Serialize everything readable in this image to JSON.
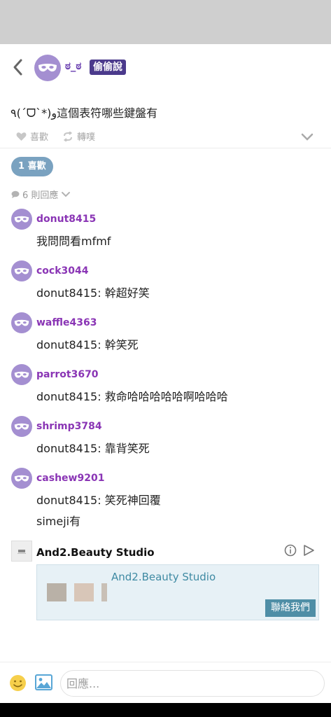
{
  "post": {
    "author": "ಠ_ಠ",
    "tag": "偷偷說",
    "text": "٩(ˊᗜˋ*)و這個表符哪些鍵盤有",
    "like_label": "喜歡",
    "share_label": "轉噗"
  },
  "likes_label": "1 喜歡",
  "replies_label": "6 則回應",
  "comments": [
    {
      "name": "donut8415",
      "text": "我問問看mfmf"
    },
    {
      "name": "cock3044",
      "text": "donut8415: 幹超好笑"
    },
    {
      "name": "waffle4363",
      "text": "donut8415: 幹笑死"
    },
    {
      "name": "parrot3670",
      "text": "donut8415: 救命哈哈哈哈哈啊哈哈哈"
    },
    {
      "name": "shrimp3784",
      "text": "donut8415: 靠背笑死"
    },
    {
      "name": "cashew9201",
      "text": "donut8415: 笑死神回覆",
      "text2": "simeji有"
    }
  ],
  "ad": {
    "name": "And2.Beauty Studio",
    "box_title": "And2.Beauty Studio",
    "button": "聯絡我們"
  },
  "footer": {
    "placeholder": "回應..."
  },
  "colors": {
    "accent_purple": "#8a35b5",
    "tag_bg": "#4b3a8c",
    "avatar": "#a48fd1",
    "likes_pill": "#7aa2c0",
    "ad_button": "#4f8ea6"
  },
  "icons": [
    "back-arrow-icon",
    "mask-icon",
    "heart-icon",
    "repost-icon",
    "chevron-down-icon",
    "comment-bubble-icon",
    "info-icon",
    "play-icon",
    "emoji-icon",
    "image-icon"
  ]
}
